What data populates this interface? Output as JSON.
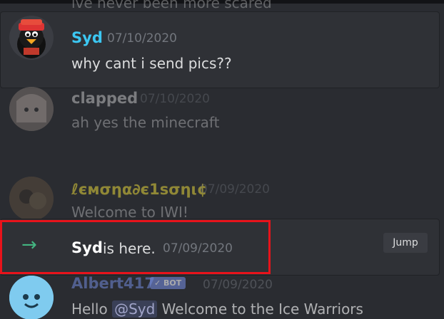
{
  "top_fragment": {
    "text": "ive never been more scared"
  },
  "messages": [
    {
      "author": "Syd",
      "timestamp": "07/10/2020",
      "text": "why cant i send pics??",
      "name_color": "#3cc7f2"
    },
    {
      "author": "clapped",
      "timestamp": "07/10/2020",
      "text": "ah yes the minecraft",
      "name_color": "#ffffff"
    },
    {
      "author": "ℓємσηα∂є1ѕσηι¢",
      "timestamp": "07/09/2020",
      "text": "Welcome to IWI!",
      "name_color": "#d4c53a"
    },
    {
      "author": "Albert417",
      "badge": "✓ BOT",
      "timestamp": "07/09/2020",
      "mention": "@Syd",
      "text": "Welcome to the Ice Warriors",
      "greeting": "Hello",
      "name_color": "#7289da"
    }
  ],
  "join_notice": {
    "user": "Syd",
    "text": "is here.",
    "timestamp": "07/09/2020",
    "jump_label": "Jump",
    "arrow": "→"
  },
  "icons": {
    "arrow": "arrow-right-icon"
  },
  "colors": {
    "background": "#2a2c31",
    "card": "#2f3136",
    "highlight": "#e8131b",
    "join_arrow": "#43b581"
  }
}
